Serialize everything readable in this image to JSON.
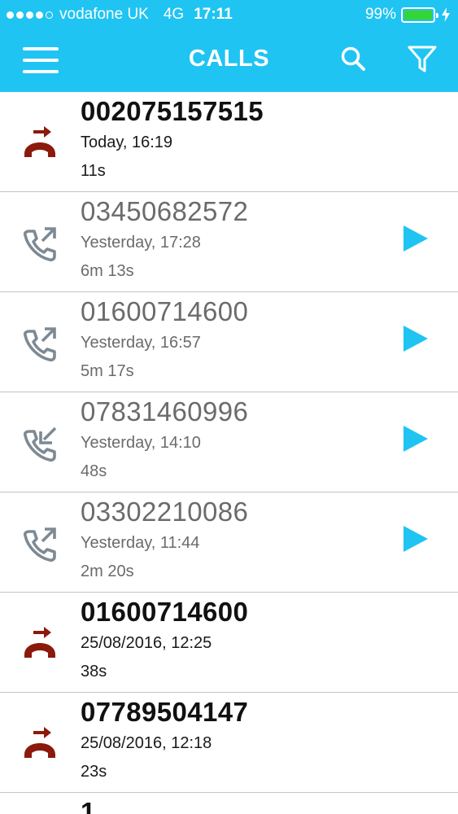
{
  "status_bar": {
    "carrier": "vodafone UK",
    "network": "4G",
    "time": "17:11",
    "battery": "99%",
    "battery_level": 0.99,
    "signal_bars": 4,
    "signal_max": 5
  },
  "header": {
    "title": "CALLS",
    "menu_icon": "hamburger-menu-icon",
    "search_icon": "search-icon",
    "filter_icon": "filter-funnel-icon",
    "background_color": "#1fc4f2"
  },
  "colors": {
    "missed": "#8b1a0c",
    "normal_icon": "#7d8a94",
    "play": "#1fc4f2"
  },
  "calls": [
    {
      "number": "002075157515",
      "when": "Today, 16:19",
      "duration": "11s",
      "type": "outgoing-unanswered",
      "bold": true,
      "has_recording": false
    },
    {
      "number": "03450682572",
      "when": "Yesterday, 17:28",
      "duration": "6m 13s",
      "type": "outgoing",
      "bold": false,
      "has_recording": true
    },
    {
      "number": "01600714600",
      "when": "Yesterday, 16:57",
      "duration": "5m 17s",
      "type": "outgoing",
      "bold": false,
      "has_recording": true
    },
    {
      "number": "07831460996",
      "when": "Yesterday, 14:10",
      "duration": "48s",
      "type": "incoming",
      "bold": false,
      "has_recording": true
    },
    {
      "number": "03302210086",
      "when": "Yesterday, 11:44",
      "duration": "2m 20s",
      "type": "outgoing",
      "bold": false,
      "has_recording": true
    },
    {
      "number": "01600714600",
      "when": "25/08/2016, 12:25",
      "duration": "38s",
      "type": "outgoing-unanswered",
      "bold": true,
      "has_recording": false
    },
    {
      "number": "07789504147",
      "when": "25/08/2016, 12:18",
      "duration": "23s",
      "type": "outgoing-unanswered",
      "bold": true,
      "has_recording": false
    }
  ],
  "partial_row": {
    "number": "1"
  }
}
